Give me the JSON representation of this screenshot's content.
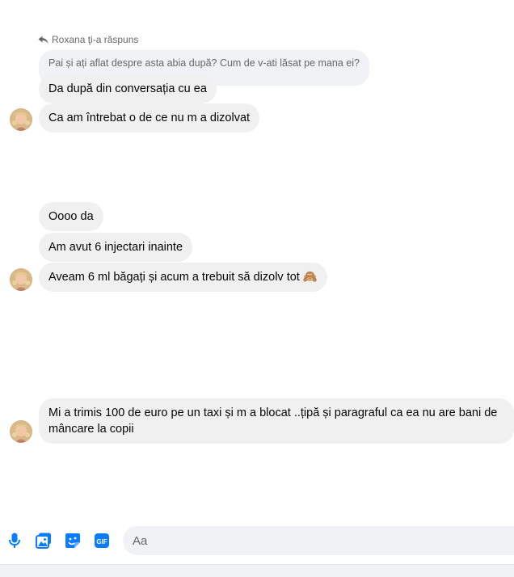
{
  "reply": {
    "header": "Roxana ţi-a răspuns",
    "quoted": "Pai și ați aflat despre asta abia după? Cum de v-ati lăsat pe mana ei?"
  },
  "messages": [
    {
      "text": "Da după din conversația cu ea"
    },
    {
      "text": "Ca am întrebat o de ce nu m a dizolvat"
    },
    {
      "text": "Oooo da"
    },
    {
      "text": "Am avut 6 injectari inainte"
    },
    {
      "text": "Aveam 6 ml băgați și acum a trebuit să dizolv tot",
      "emoji": "🙈"
    },
    {
      "text": "Mi a trimis 100 de euro pe un taxi și m a blocat ..țipă și paragraful ca ea nu are bani de mâncare la copii"
    }
  ],
  "composer": {
    "placeholder": "Aa",
    "icons": [
      "microphone-icon",
      "photo-icon",
      "sticker-icon",
      "gif-icon"
    ],
    "gif_label": "GIF",
    "accent": "#0a7cff"
  }
}
